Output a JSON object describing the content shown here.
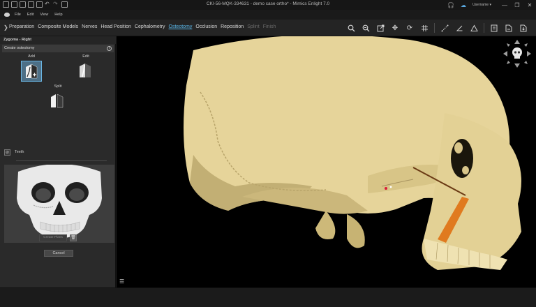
{
  "window": {
    "title": "CKI-56-MQK-334631 - demo case ortho* - Mimics Enlight 7.0",
    "user": "Username",
    "controls": [
      "minimize",
      "maximize",
      "close"
    ]
  },
  "menu": {
    "items": [
      "File",
      "Edit",
      "View",
      "Help"
    ]
  },
  "workflow": {
    "tabs": [
      {
        "label": "Preparation",
        "state": "normal"
      },
      {
        "label": "Composite Models",
        "state": "normal"
      },
      {
        "label": "Nerves",
        "state": "normal"
      },
      {
        "label": "Head Position",
        "state": "normal"
      },
      {
        "label": "Cephalometry",
        "state": "normal"
      },
      {
        "label": "Osteotomy",
        "state": "active"
      },
      {
        "label": "Occlusion",
        "state": "normal"
      },
      {
        "label": "Reposition",
        "state": "normal"
      },
      {
        "label": "Splint",
        "state": "disabled"
      },
      {
        "label": "Finish",
        "state": "disabled"
      }
    ],
    "toolbar_icons": [
      "search-icon",
      "zoom-icon",
      "fit-icon",
      "pan-icon",
      "rotate-icon",
      "grid-icon",
      "measure-distance-icon",
      "measure-angle-icon",
      "measure-triangle-icon",
      "report-icon",
      "export-pdf-icon",
      "export-file-icon"
    ]
  },
  "panel": {
    "header": "Zygoma - Right",
    "section": "Create osteotomy",
    "add_label": "Add",
    "edit_label": "Edit",
    "split_label": "Split",
    "teeth_label": "Teeth",
    "create_planes_label": "Create Plans",
    "cancel_label": "Cancel"
  },
  "colors": {
    "accent": "#58b4e6",
    "bone": "#e6d49a",
    "osteotomy_plane": "#e07a1f",
    "viewport_bg": "#000000"
  }
}
